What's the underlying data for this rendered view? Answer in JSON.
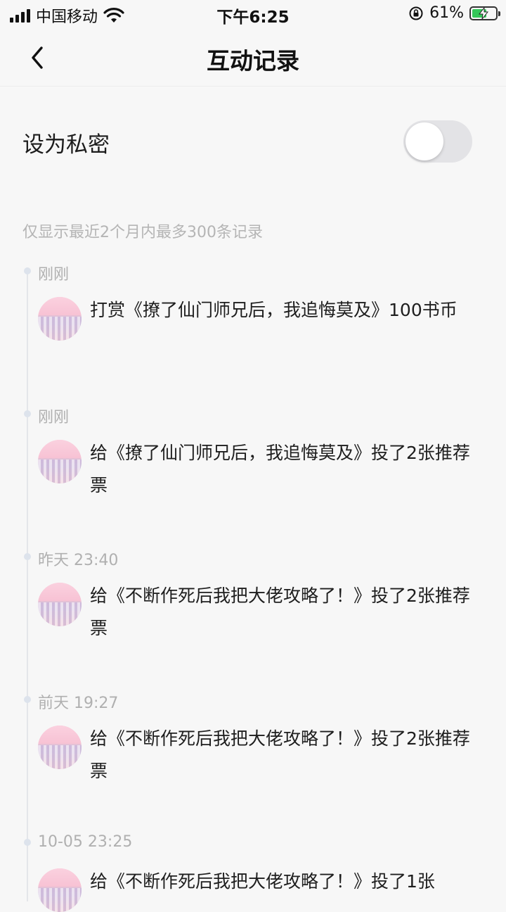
{
  "status_bar": {
    "carrier": "中国移动",
    "time": "下午6:25",
    "battery_percent": "61%",
    "battery_level": 0.61
  },
  "nav": {
    "title": "互动记录"
  },
  "privacy": {
    "label": "设为私密",
    "toggle_on": false
  },
  "note": "仅显示最近2个月内最多300条记录",
  "records": [
    {
      "time": "刚刚",
      "text": "打赏《撩了仙门师兄后，我追悔莫及》100书币"
    },
    {
      "time": "刚刚",
      "text": "给《撩了仙门师兄后，我追悔莫及》投了2张推荐票"
    },
    {
      "time": "昨天 23:40",
      "text": "给《不断作死后我把大佬攻略了！》投了2张推荐票"
    },
    {
      "time": "前天 19:27",
      "text": "给《不断作死后我把大佬攻略了！》投了2张推荐票"
    },
    {
      "time": "10-05 23:25",
      "text": "给《不断作死后我把大佬攻略了！》投了1张"
    }
  ],
  "colors": {
    "background": "#f7f7f7",
    "toggle_off": "#e3e3e6",
    "battery_green": "#34c759",
    "muted_text": "#b0b0b0"
  }
}
